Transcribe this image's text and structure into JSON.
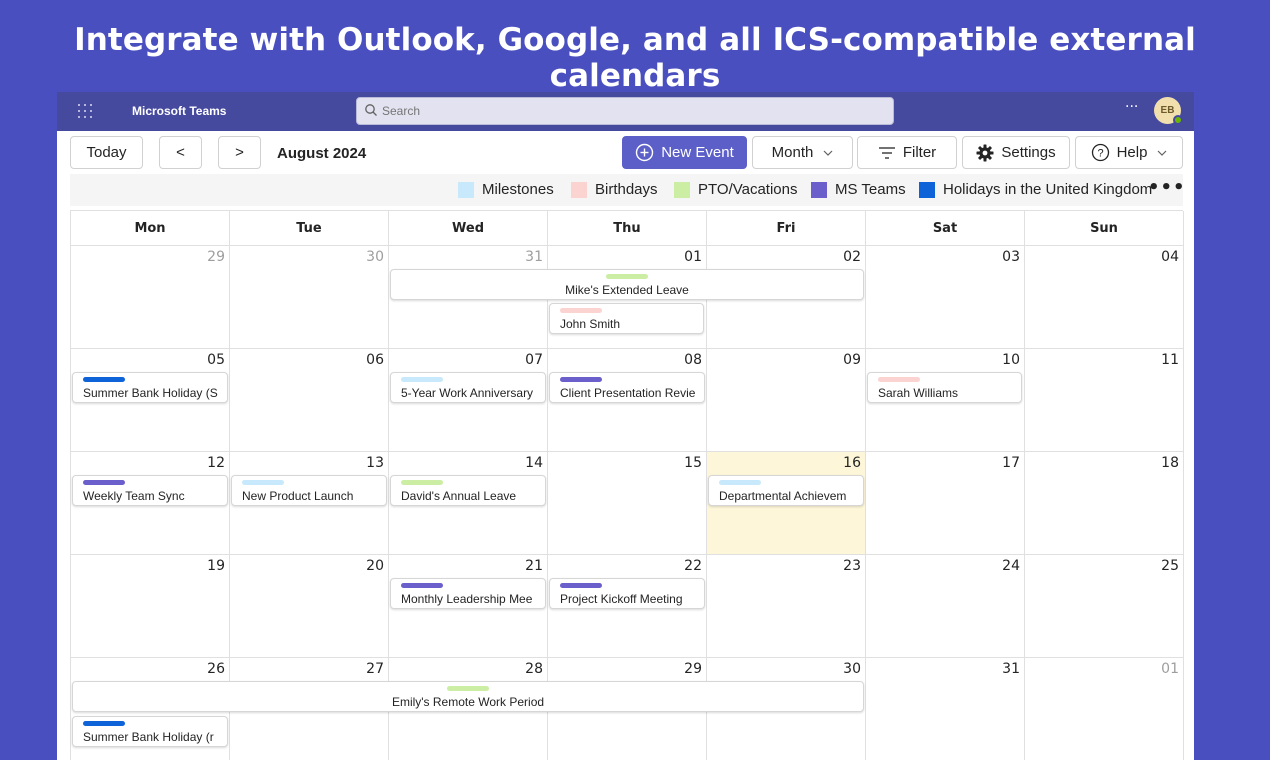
{
  "headline": "Integrate with Outlook, Google, and all ICS-compatible external calendars",
  "app": {
    "name": "Microsoft Teams",
    "search_placeholder": "Search",
    "more": "···",
    "avatar_initials": "EB"
  },
  "toolbar": {
    "today": "Today",
    "prev": "<",
    "next": ">",
    "month_title": "August 2024",
    "new_event": "New Event",
    "view": "Month",
    "filter": "Filter",
    "settings": "Settings",
    "help": "Help"
  },
  "colors": {
    "milestones": "#c7e9fb",
    "birthdays": "#fbd3d1",
    "pto": "#cceea4",
    "msteams": "#6b5fcc",
    "holidays": "#0f63d8",
    "today_bg": "#fdf6d9",
    "brand": "#5b5fc7"
  },
  "legend": [
    {
      "label": "Milestones",
      "color": "#c7e9fb"
    },
    {
      "label": "Birthdays",
      "color": "#fbd3d1"
    },
    {
      "label": "PTO/Vacations",
      "color": "#cceea4"
    },
    {
      "label": "MS Teams",
      "color": "#6b5fcc"
    },
    {
      "label": "Holidays in the United Kingdom",
      "color": "#0f63d8"
    }
  ],
  "legend_more": "•••",
  "weekdays": [
    "Mon",
    "Tue",
    "Wed",
    "Thu",
    "Fri",
    "Sat",
    "Sun"
  ],
  "days": [
    [
      "29",
      "30",
      "31",
      "01",
      "02",
      "03",
      "04"
    ],
    [
      "05",
      "06",
      "07",
      "08",
      "09",
      "10",
      "11"
    ],
    [
      "12",
      "13",
      "14",
      "15",
      "16",
      "17",
      "18"
    ],
    [
      "19",
      "20",
      "21",
      "22",
      "23",
      "24",
      "25"
    ],
    [
      "26",
      "27",
      "28",
      "29",
      "30",
      "31",
      "01"
    ]
  ],
  "events": [
    {
      "title": "Mike's Extended Leave",
      "color": "#cceea4"
    },
    {
      "title": "John Smith",
      "color": "#fbd3d1"
    },
    {
      "title": "Summer Bank Holiday (S",
      "color": "#0f63d8"
    },
    {
      "title": "5-Year Work Anniversary",
      "color": "#c7e9fb"
    },
    {
      "title": "Client Presentation Revie",
      "color": "#6b5fcc"
    },
    {
      "title": "Sarah Williams",
      "color": "#fbd3d1"
    },
    {
      "title": "Weekly Team Sync",
      "color": "#6b5fcc"
    },
    {
      "title": "New Product Launch",
      "color": "#c7e9fb"
    },
    {
      "title": "David's Annual Leave",
      "color": "#cceea4"
    },
    {
      "title": "Departmental Achievem",
      "color": "#c7e9fb"
    },
    {
      "title": "Monthly Leadership Mee",
      "color": "#6b5fcc"
    },
    {
      "title": "Project Kickoff Meeting",
      "color": "#6b5fcc"
    },
    {
      "title": "Emily's Remote Work Period",
      "color": "#cceea4"
    },
    {
      "title": "Summer Bank Holiday (r",
      "color": "#0f63d8"
    }
  ]
}
